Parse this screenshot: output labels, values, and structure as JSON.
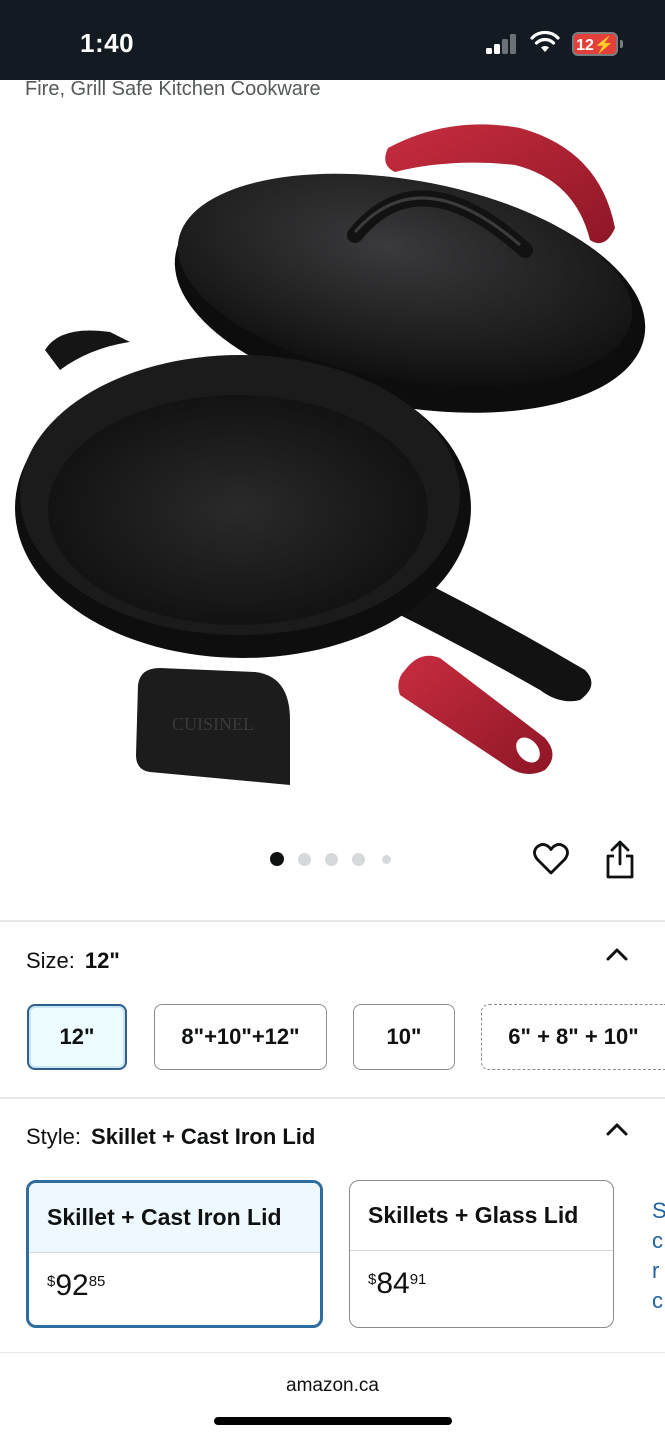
{
  "status_bar": {
    "time": "1:40",
    "battery": "12"
  },
  "product": {
    "title_tail": "Fire, Grill Safe Kitchen Cookware",
    "brand_mark": "CUISINEL"
  },
  "carousel": {
    "dot_count": 5,
    "active_index": 0
  },
  "size": {
    "label": "Size:",
    "selected": "12\"",
    "options": [
      "12\"",
      "8\"+10\"+12\"",
      "10\"",
      "6\" + 8\" + 10\""
    ]
  },
  "style": {
    "label": "Style:",
    "selected": "Skillet + Cast Iron Lid",
    "options": [
      {
        "name": "Skillet + Cast Iron Lid",
        "currency": "$",
        "whole": "92",
        "fraction": "85"
      },
      {
        "name": "Skillets + Glass Lid",
        "currency": "$",
        "whole": "84",
        "fraction": "91"
      }
    ],
    "peek_letters": [
      "S",
      "c",
      "r",
      "c"
    ]
  },
  "footer": {
    "domain": "amazon.ca"
  },
  "colors": {
    "status_bg": "#131a22",
    "selected_border": "#2e6d9e",
    "handle_red": "#b21f32",
    "link": "#2162a1"
  }
}
